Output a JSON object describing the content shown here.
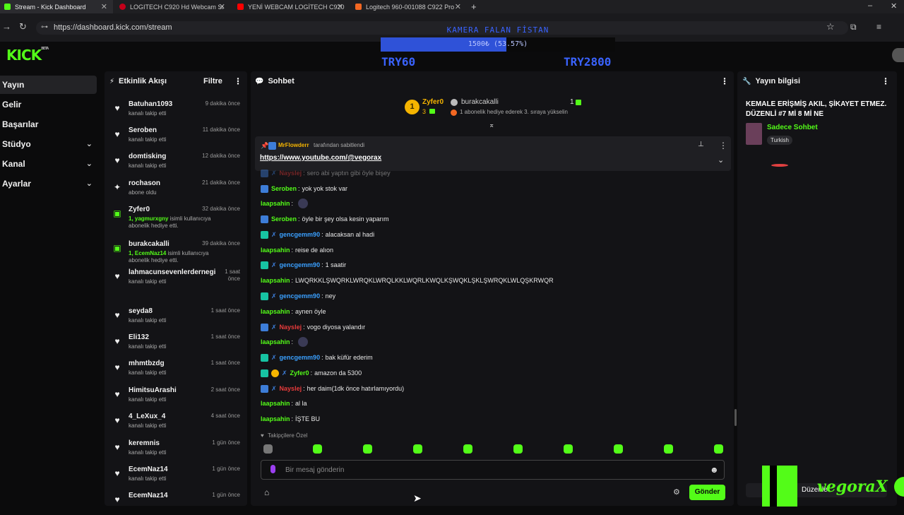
{
  "browser": {
    "tabs": [
      {
        "label": "Stream - Kick Dashboard",
        "color": "#53fc18",
        "active": true
      },
      {
        "label": "LOGITECH C920 Hd Webcam Sı",
        "color": "#c4001a"
      },
      {
        "label": "YENİ WEBCAM LOGİTECH C920",
        "color": "#ff0000"
      },
      {
        "label": "Logitech 960-001088 C922 Pro",
        "color": "#f26722"
      }
    ],
    "url": "https://dashboard.kick.com/stream"
  },
  "overlay": {
    "title": "KAMERA FALAN FİSTAN",
    "progress_text": "1500₺ (53.57%)",
    "progress_fraction": 0.5357,
    "goal_left": "TRY60",
    "goal_right": "TRY2800"
  },
  "brand": {
    "logo": "KICK",
    "logo_sup": "BETA",
    "accent": "#53fc18"
  },
  "sidebar": {
    "items": [
      {
        "label": "Yayın",
        "active": true
      },
      {
        "label": "Gelir"
      },
      {
        "label": "Başarılar"
      },
      {
        "label": "Stüdyo",
        "chevron": true
      },
      {
        "label": "Kanal",
        "chevron": true
      },
      {
        "label": "Ayarlar",
        "chevron": true
      }
    ]
  },
  "activity": {
    "title": "Etkinlik Akışı",
    "filter": "Filtre",
    "items": [
      {
        "icon": "heart",
        "name": "Batuhan1093",
        "sub": "kanalı takip etti",
        "time": "9 dakika önce"
      },
      {
        "icon": "heart",
        "name": "Seroben",
        "sub": "kanalı takip etti",
        "time": "11 dakika önce"
      },
      {
        "icon": "heart",
        "name": "domtisking",
        "sub": "kanalı takip etti",
        "time": "12 dakika önce"
      },
      {
        "icon": "star",
        "name": "rochason",
        "sub": "abone oldu",
        "time": "21 dakika önce"
      },
      {
        "icon": "gift",
        "name": "Zyfer0",
        "sub_hl": "1, yagmurxgny",
        "sub": " isimli kullanıcıya abonelik hediye etti.",
        "time": "32 dakika önce"
      },
      {
        "icon": "gift",
        "name": "burakcakalli",
        "sub_hl": "1, EcemNaz14",
        "sub": " isimli kullanıcıya abonelik hediye etti.",
        "time": "39 dakika önce"
      },
      {
        "icon": "heart",
        "name": "lahmacunsevenlerdernegi",
        "sub": "kanalı takip etti",
        "time": "1 saat önce"
      },
      {
        "icon": "heart",
        "name": "seyda8",
        "sub": "kanalı takip etti",
        "time": "1 saat önce"
      },
      {
        "icon": "heart",
        "name": "Eli132",
        "sub": "kanalı takip etti",
        "time": "1 saat önce"
      },
      {
        "icon": "heart",
        "name": "mhmtbzdg",
        "sub": "kanalı takip etti",
        "time": "1 saat önce"
      },
      {
        "icon": "heart",
        "name": "HimitsuArashi",
        "sub": "kanalı takip etti",
        "time": "2 saat önce"
      },
      {
        "icon": "heart",
        "name": "4_LeXux_4",
        "sub": "kanalı takip etti",
        "time": "4 saat önce"
      },
      {
        "icon": "heart",
        "name": "keremnis",
        "sub": "kanalı takip etti",
        "time": "1 gün önce"
      },
      {
        "icon": "heart",
        "name": "EcemNaz14",
        "sub": "kanalı takip etti",
        "time": "1 gün önce"
      },
      {
        "icon": "heart",
        "name": "EcemNaz14",
        "sub": "",
        "time": "1 gün önce"
      }
    ]
  },
  "chat": {
    "title": "Sohbet",
    "top_gifter": {
      "name": "Zyfer0",
      "rank": "1",
      "count": "3"
    },
    "gifter2": {
      "name": "burakcakalli",
      "count": "1",
      "note": "1 abonelik hediye ederek 3. sıraya yükselin"
    },
    "pinned": {
      "by": "MrFlowderr",
      "by_suffix": "tarafından sabitlendi",
      "link": "https://www.youtube.com/@vegorax"
    },
    "messages": [
      {
        "badges": [
          "mod",
          "x"
        ],
        "user": "Nayslej",
        "color": "#e83b3b",
        "text": "sero abi yaptın gibi öyle bişey",
        "faded": true
      },
      {
        "badges": [
          "mod"
        ],
        "user": "Seroben",
        "color": "#53fc18",
        "text": "yok yok stok var"
      },
      {
        "badges": [],
        "user": "laapsahin",
        "color": "#53fc18",
        "text": "",
        "emote": true
      },
      {
        "badges": [
          "mod"
        ],
        "user": "Seroben",
        "color": "#53fc18",
        "text": "öyle bir şey olsa kesin yaparım"
      },
      {
        "badges": [
          "vip",
          "x"
        ],
        "user": "gencgemm90",
        "color": "#3aa0ff",
        "text": "alacaksan al hadi"
      },
      {
        "badges": [],
        "user": "laapsahin",
        "color": "#53fc18",
        "text": "reise de alıon"
      },
      {
        "badges": [
          "vip",
          "x"
        ],
        "user": "gencgemm90",
        "color": "#3aa0ff",
        "text": "1 saatir"
      },
      {
        "badges": [],
        "user": "laapsahin",
        "color": "#53fc18",
        "text": "LWQRKKLŞWQRKLWRQKLWRQLKKLWQRLKWQLKŞWQKLŞKLŞWRQKLWLQŞKRWQR"
      },
      {
        "badges": [
          "vip",
          "x"
        ],
        "user": "gencgemm90",
        "color": "#3aa0ff",
        "text": "ney"
      },
      {
        "badges": [],
        "user": "laapsahin",
        "color": "#53fc18",
        "text": "aynen öyle"
      },
      {
        "badges": [
          "mod",
          "x"
        ],
        "user": "Nayslej",
        "color": "#e83b3b",
        "text": "vogo diyosa yalandır"
      },
      {
        "badges": [],
        "user": "laapsahin",
        "color": "#53fc18",
        "text": "",
        "emote": true
      },
      {
        "badges": [
          "vip",
          "x"
        ],
        "user": "gencgemm90",
        "color": "#3aa0ff",
        "text": "bak küfür ederim"
      },
      {
        "badges": [
          "vip",
          "sub",
          "x"
        ],
        "user": "Zyfer0",
        "color": "#53fc18",
        "text": "amazon da 5300"
      },
      {
        "badges": [
          "mod",
          "x"
        ],
        "user": "Nayslej",
        "color": "#e83b3b",
        "text": "her daim(1dk önce hatırlamıyordu)"
      },
      {
        "badges": [],
        "user": "laapsahin",
        "color": "#53fc18",
        "text": "al la"
      },
      {
        "badges": [],
        "user": "laapsahin",
        "color": "#53fc18",
        "text": "İŞTE BU"
      }
    ],
    "followers_only": "Takipçilere Özel",
    "input_placeholder": "Bir mesaj gönderin",
    "send_label": "Gönder"
  },
  "stream_info": {
    "title": "Yayın bilgisi",
    "stream_title": "KEMALE ERİŞMİŞ AKIL, ŞİKAYET ETMEZ. DÜZENLİ #7 Mİ 8 Mİ NE",
    "mode": "Sadece Sohbet",
    "language": "Turkish"
  },
  "webcam_overlay": {
    "watermark": "vegoraX",
    "edit_label": "Düzenle"
  }
}
